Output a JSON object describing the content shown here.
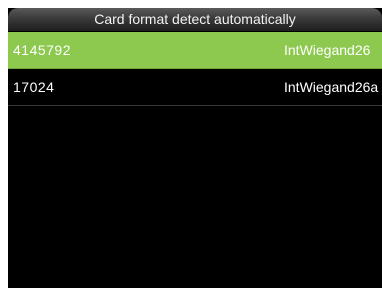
{
  "header": {
    "title": "Card format detect automatically"
  },
  "cards": [
    {
      "number": "4145792",
      "format": "IntWiegand26",
      "selected": true
    },
    {
      "number": "17024",
      "format": "IntWiegand26a",
      "selected": false
    }
  ],
  "colors": {
    "selected_row": "#8dc84f",
    "background": "#000000",
    "text": "#ffffff"
  }
}
